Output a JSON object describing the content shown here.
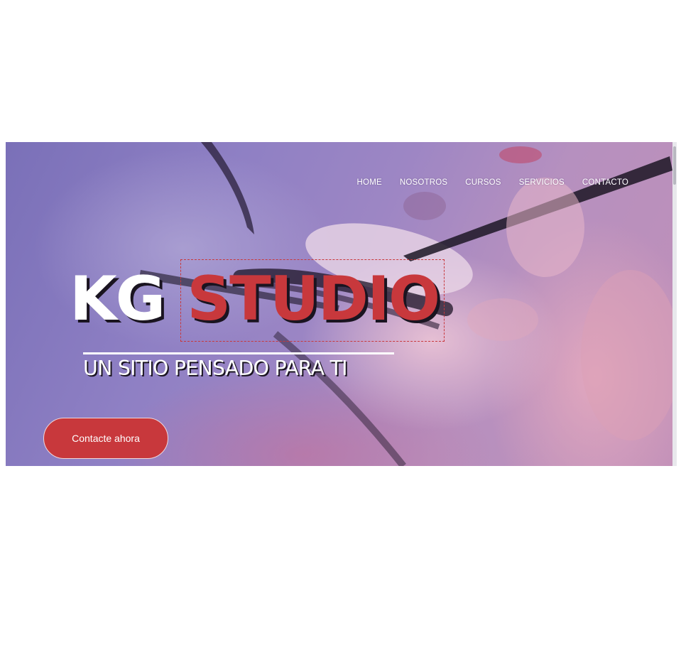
{
  "nav": {
    "items": [
      {
        "label": "HOME"
      },
      {
        "label": "NOSOTROS"
      },
      {
        "label": "CURSOS"
      },
      {
        "label": "SERVICIOS"
      },
      {
        "label": "CONTACTO"
      }
    ]
  },
  "hero": {
    "title_part1": "KG",
    "title_part2": "STUDIO",
    "subtitle": "UN SITIO PENSADO PARA TI",
    "cta_label": "Contacte ahora",
    "image_description_icon": "eyelash-extension-photo"
  },
  "colors": {
    "accent": "#c8383c",
    "overlay": "#8f80c4",
    "text": "#ffffff"
  }
}
